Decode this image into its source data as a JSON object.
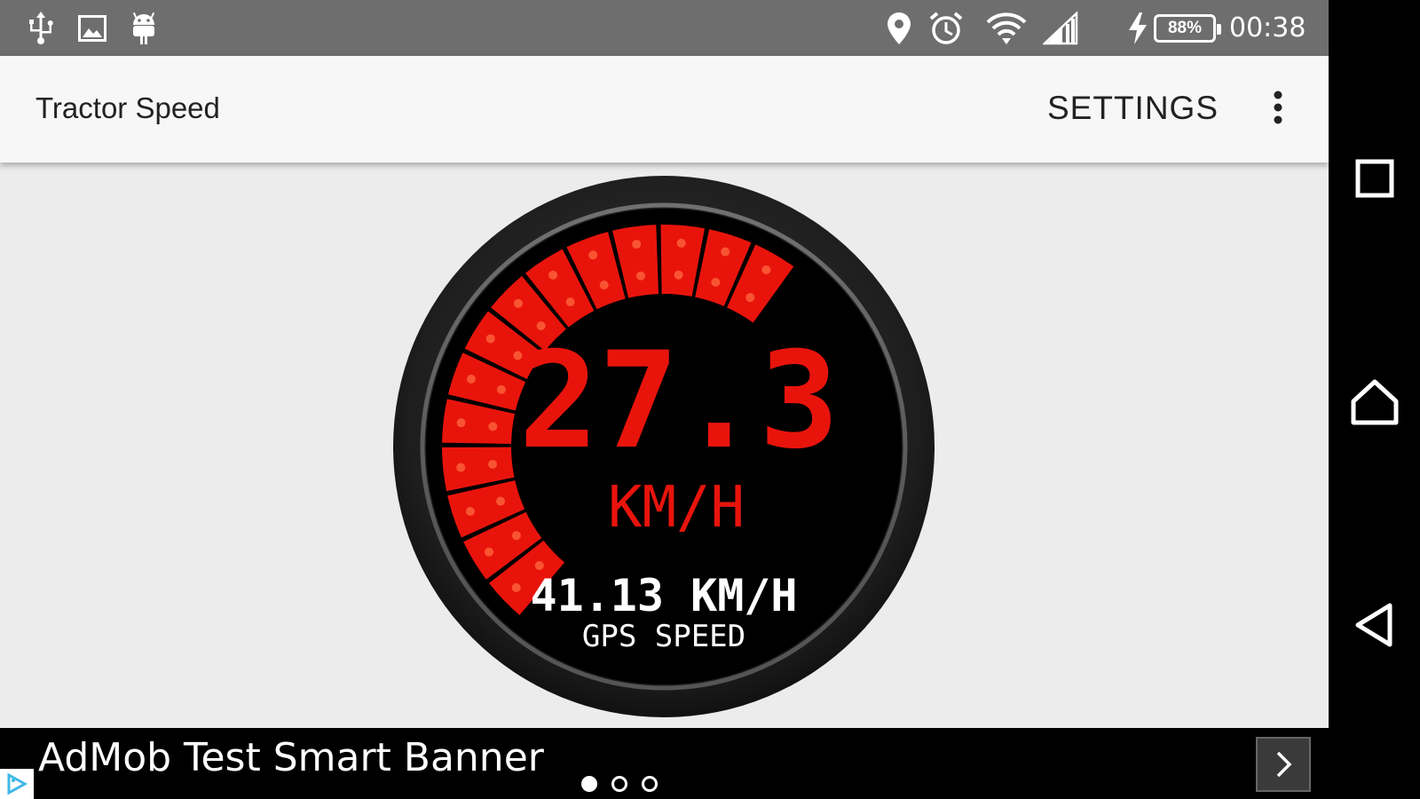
{
  "status_bar": {
    "time": "00:38",
    "battery_level": "88%",
    "icons": [
      "usb-icon",
      "image-icon",
      "android-icon",
      "location-icon",
      "alarm-icon",
      "wifi-icon",
      "signal-icon",
      "charging-icon",
      "battery-icon"
    ]
  },
  "app_bar": {
    "title": "Tractor Speed",
    "settings_label": "SETTINGS",
    "overflow_icon": "more-vert-icon"
  },
  "gauge": {
    "speed_value": "27.3",
    "speed_unit": "KM/H",
    "gps_speed": "41.13 KM/H",
    "gps_label": "GPS SPEED",
    "lit_segments": 14,
    "accent_color": "#e8140c",
    "dot_color": "#ff6a3d",
    "face_color": "#000000",
    "bezel_color": "#222222"
  },
  "ad_banner": {
    "text": "AdMob Test Smart Banner",
    "page_count": 3,
    "active_page": 0,
    "arrow_icon": "chevron-right-icon",
    "badge_icon": "adchoices-icon"
  },
  "nav_bar": {
    "buttons": [
      "recents-icon",
      "home-icon",
      "back-icon"
    ]
  }
}
